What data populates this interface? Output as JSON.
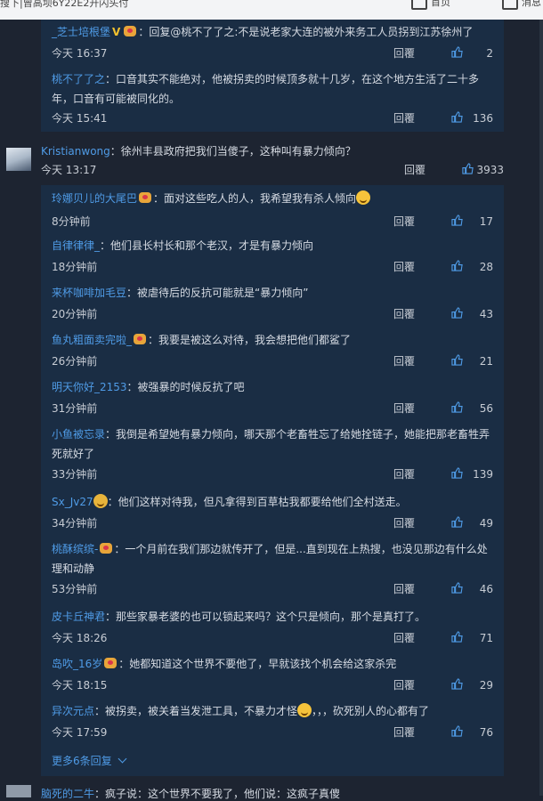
{
  "topbar": {
    "search_text": "搜下|曾高坝6Y22E2开闪头付",
    "home_label": "首页",
    "msg_label": "消息"
  },
  "first_thread": {
    "replies": [
      {
        "user": "_芝士培根堡",
        "verified": "V",
        "text": "：回复@桃不了了之:不是说老家大连的被外来务工人员拐到江苏徐州了",
        "time": "今天 16:37",
        "reply_label": "回覆",
        "likes": "2"
      },
      {
        "user": "桃不了了之",
        "text": "：口音其实不能绝对，他被拐卖的时候顶多就十几岁，在这个地方生活了二十多年，口音有可能被同化的。",
        "time": "今天 15:41",
        "reply_label": "回覆",
        "likes": "136"
      }
    ]
  },
  "main_comment": {
    "user": "Kristianwong",
    "text": "：徐州丰县政府把我们当傻子，这种叫有暴力倾向？",
    "time": "今天 13:17",
    "reply_label": "回覆",
    "likes": "3933"
  },
  "replies": [
    {
      "user": "玲娜贝儿的大尾巴",
      "text": "：面对这些吃人的人，我希望我有杀人倾向",
      "time": "8分钟前",
      "reply_label": "回覆",
      "likes": "17"
    },
    {
      "user": "自律律律_",
      "text": "：他们县长村长和那个老汉，才是有暴力倾向",
      "time": "18分钟前",
      "reply_label": "回覆",
      "likes": "28"
    },
    {
      "user": "来杯咖啡加毛豆",
      "text": "：被虐待后的反抗可能就是“暴力倾向”",
      "time": "20分钟前",
      "reply_label": "回覆",
      "likes": "43"
    },
    {
      "user": "鱼丸粗面卖完啦_",
      "text": "：我要是被这么对待，我会想把他们都鲨了",
      "time": "26分钟前",
      "reply_label": "回覆",
      "likes": "21"
    },
    {
      "user": "明天你好_2153",
      "text": "：被强暴的时候反抗了吧",
      "time": "31分钟前",
      "reply_label": "回覆",
      "likes": "56"
    },
    {
      "user": "小鱼被忘录",
      "text": "：我倒是希望她有暴力倾向，哪天那个老畜牲忘了给她拴链子，她能把那老畜牲弄死就好了",
      "time": "33分钟前",
      "reply_label": "回覆",
      "likes": "139"
    },
    {
      "user": "Sx_Jv27",
      "text": "：他们这样对待我，但凡拿得到百草枯我都要给他们全村送走。",
      "time": "34分钟前",
      "reply_label": "回覆",
      "likes": "49"
    },
    {
      "user": "桃酥缤缤-",
      "text": "：一个月前在我们那边就传开了，但是...直到现在上热搜，也没见那边有什么处理和动静",
      "time": "53分钟前",
      "reply_label": "回覆",
      "likes": "46"
    },
    {
      "user": "皮卡丘神君",
      "text": "：那些家暴老婆的也可以锁起来吗？这个只是倾向，那个是真打了。",
      "time": "今天 18:26",
      "reply_label": "回覆",
      "likes": "71"
    },
    {
      "user": "岛吹_16岁",
      "text": "：她都知道这个世界不要他了，早就该找个机会给这家杀完",
      "time": "今天 18:15",
      "reply_label": "回覆",
      "likes": "29"
    },
    {
      "user": "异次元点",
      "text": "：被拐卖，被关着当发泄工具，不暴力才怪",
      "text_after": "，，，砍死别人的心都有了",
      "time": "今天 17:59",
      "reply_label": "回覆",
      "likes": "76"
    }
  ],
  "more_replies_label": "更多6条回复",
  "bottom_comment": {
    "user": "脑死的二牛",
    "text": "：疯子说：这个世界不要我了，他们说：这疯子真傻"
  }
}
